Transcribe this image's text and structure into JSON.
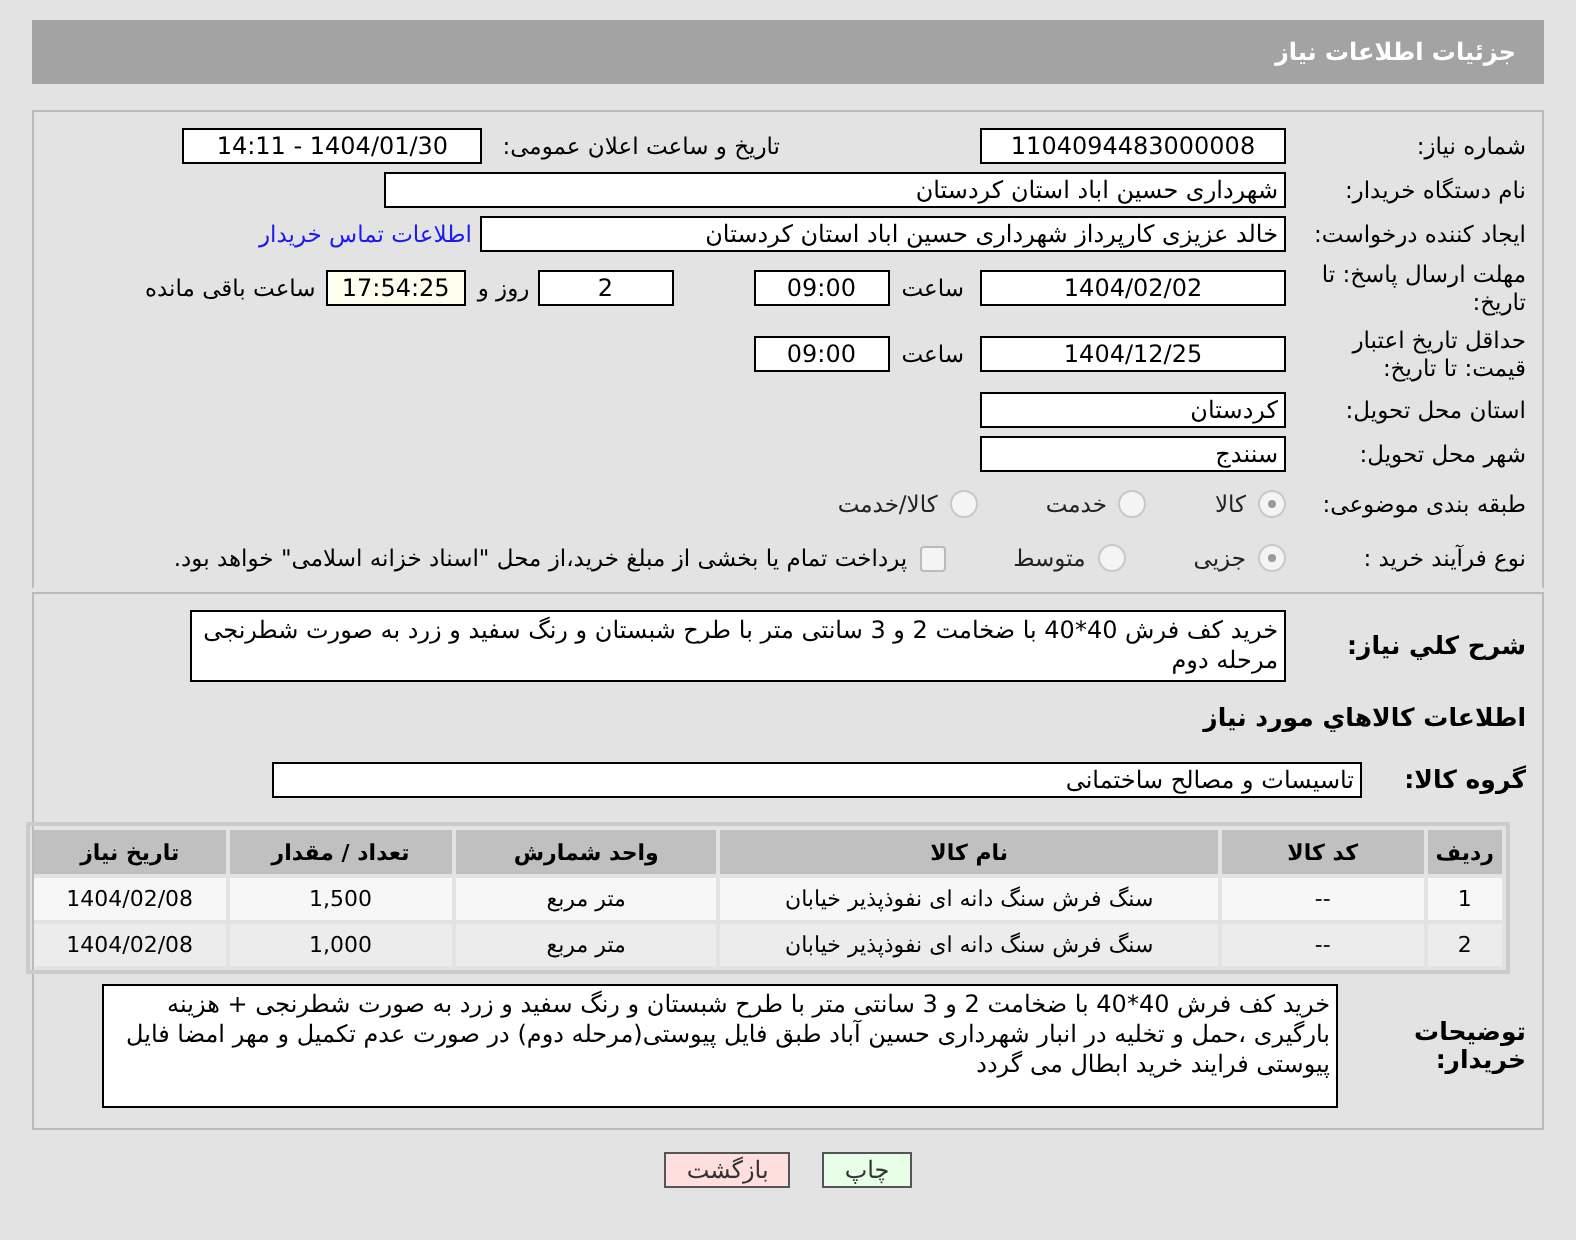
{
  "header": {
    "title": "جزئیات اطلاعات نیاز"
  },
  "need_number": {
    "label": "شماره نیاز:",
    "value": "1104094483000008"
  },
  "announce": {
    "label": "تاریخ و ساعت اعلان عمومی:",
    "value": "1404/01/30 - 14:11"
  },
  "buyer_org": {
    "label": "نام دستگاه خریدار:",
    "value": "شهرداری حسین اباد استان کردستان"
  },
  "creator": {
    "label": "ایجاد کننده درخواست:",
    "value": "خالد عزیزی کارپرداز شهرداری حسین اباد استان کردستان",
    "link": "اطلاعات تماس خریدار"
  },
  "deadline": {
    "label": "مهلت ارسال پاسخ: تا تاریخ:",
    "date": "1404/02/02",
    "time_label": "ساعت",
    "time": "09:00",
    "days": "2",
    "days_label": "روز و",
    "remaining": "17:54:25",
    "remaining_label": "ساعت باقی مانده"
  },
  "validity": {
    "label": "حداقل تاریخ اعتبار قیمت: تا تاریخ:",
    "date": "1404/12/25",
    "time_label": "ساعت",
    "time": "09:00"
  },
  "province": {
    "label": "استان محل تحویل:",
    "value": "کردستان"
  },
  "city": {
    "label": "شهر محل تحویل:",
    "value": "سنندج"
  },
  "category": {
    "label": "طبقه بندی موضوعی:",
    "options": [
      {
        "label": "کالا",
        "selected": true
      },
      {
        "label": "خدمت",
        "selected": false
      },
      {
        "label": "کالا/خدمت",
        "selected": false
      }
    ]
  },
  "process": {
    "label": "نوع فرآیند خرید :",
    "options": [
      {
        "label": "جزیی",
        "selected": true
      },
      {
        "label": "متوسط",
        "selected": false
      }
    ],
    "payment_checked": false,
    "payment_note": "پرداخت تمام یا بخشی از مبلغ خرید،از محل \"اسناد خزانه اسلامی\" خواهد بود."
  },
  "summary": {
    "label": "شرح کلي نياز:",
    "value": "خرید کف فرش 40*40 با ضخامت  2 و 3 سانتی متر  با طرح شبستان و  رنگ سفید و زرد به صورت شطرنجی مرحله دوم"
  },
  "goods_title": "اطلاعات کالاهاي مورد نياز",
  "goods_group": {
    "label": "گروه کالا:",
    "value": "تاسیسات و مصالح ساختمانی"
  },
  "table": {
    "columns": [
      "ردیف",
      "کد کالا",
      "نام کالا",
      "واحد شمارش",
      "تعداد / مقدار",
      "تاریخ نیاز"
    ],
    "rows": [
      [
        "1",
        "--",
        "سنگ فرش سنگ دانه ای نفوذپذیر خیابان",
        "متر مربع",
        "1,500",
        "1404/02/08"
      ],
      [
        "2",
        "--",
        "سنگ فرش سنگ دانه ای نفوذپذیر خیابان",
        "متر مربع",
        "1,000",
        "1404/02/08"
      ]
    ]
  },
  "notes": {
    "label": "توضیحات خریدار:",
    "value": "خرید کف فرش 40*40 با ضخامت  2 و 3 سانتی متر  با طرح شبستان و  رنگ سفید و زرد به صورت شطرنجی + هزینه بارگیری ،حمل و تخلیه در انبار شهرداری حسین آباد  طبق فایل پیوستی(مرحله دوم) در صورت عدم تکمیل و مهر امضا فایل پیوستی فرایند خرید ابطال می گردد"
  },
  "buttons": [
    {
      "label": "چاپ",
      "kind": "print"
    },
    {
      "label": "بازگشت",
      "kind": "back"
    }
  ]
}
